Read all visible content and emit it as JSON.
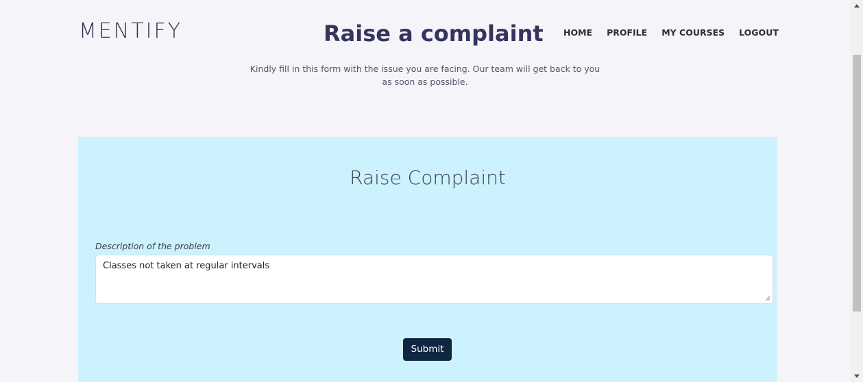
{
  "brand": {
    "logo_text": "MENTIFY"
  },
  "header": {
    "title": "Raise a complaint",
    "nav": [
      {
        "label": "HOME"
      },
      {
        "label": "PROFILE"
      },
      {
        "label": "MY COURSES"
      },
      {
        "label": "LOGOUT"
      }
    ]
  },
  "intro": {
    "text": "Kindly fill in this form with the issue you are facing. Our team will get back to you as soon as possible."
  },
  "form": {
    "title": "Raise Complaint",
    "description_label": "Description of the problem",
    "description_value": "Classes not taken at regular intervals",
    "submit_label": "Submit"
  },
  "colors": {
    "page_background": "#f5f4f9",
    "card_background": "#ccf2fd",
    "title_color": "#34345c",
    "button_background": "#0f2640"
  },
  "icons": {
    "resize_handle": "resize-grip-icon",
    "scroll_up": "scroll-up-arrow-icon",
    "scroll_down": "scroll-down-arrow-icon"
  }
}
